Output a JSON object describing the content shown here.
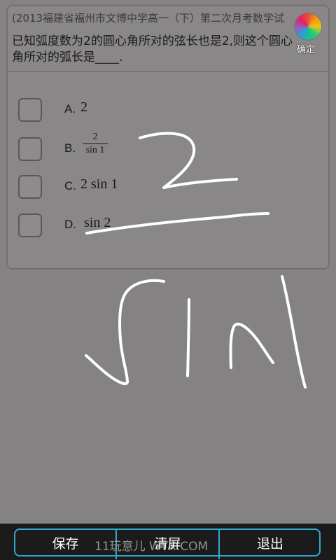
{
  "question": {
    "source": "(2013福建省福州市文博中学高一（下）第二次月考数学试",
    "text": "已知弧度数为2的圆心角所对的弦长也是2,则这个圆心角所对的弧长是____."
  },
  "options": [
    {
      "letter": "A.",
      "value": "2"
    },
    {
      "letter": "B.",
      "numerator": "2",
      "denominator": "sin 1"
    },
    {
      "letter": "C.",
      "value": "2 sin 1"
    },
    {
      "letter": "D.",
      "value": "sin 2"
    }
  ],
  "header": {
    "confirm_label": "确定",
    "palette_icon": "color-wheel-icon"
  },
  "toolbar": {
    "save_label": "保存",
    "clear_label": "清屏",
    "exit_label": "退出",
    "watermark": "11玩意儿 WYX.COM"
  },
  "colors": {
    "background": "#858284",
    "accent": "#2fa9c9",
    "ink": "#ffffff"
  }
}
